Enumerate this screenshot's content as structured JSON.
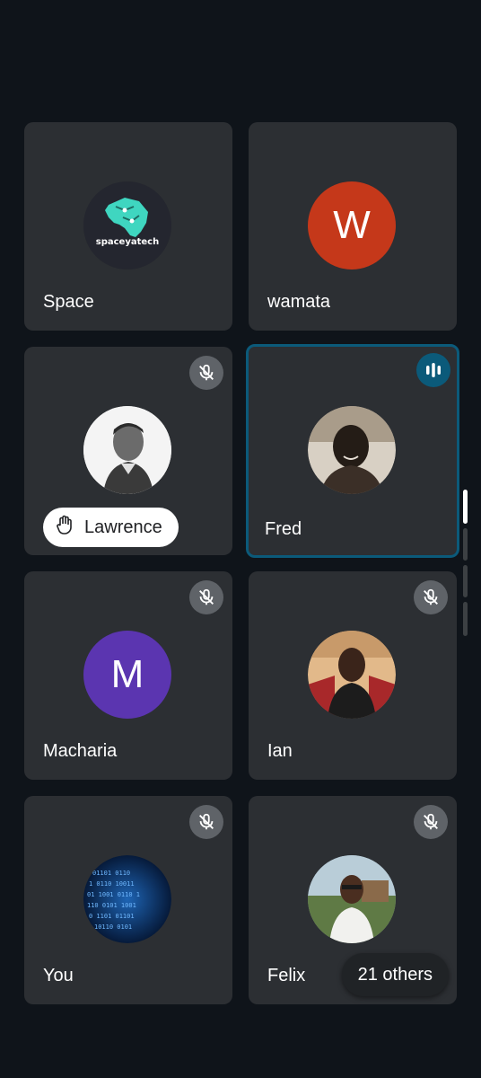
{
  "colors": {
    "background": "#0f141a",
    "tile": "#2c2f33",
    "speaking_border": "#0b5a7a",
    "mute_badge": "#5f6368"
  },
  "participants": [
    {
      "name": "Space",
      "avatar_text": "spaceyatech",
      "avatar_type": "logo",
      "muted": false
    },
    {
      "name": "wamata",
      "avatar_letter": "W",
      "avatar_color": "#c5381a",
      "muted": false
    },
    {
      "name": "Lawrence",
      "avatar_type": "photo",
      "muted": true,
      "hand_raised": true,
      "hand_icon": "raised-hand-icon"
    },
    {
      "name": "Fred",
      "avatar_type": "photo",
      "muted": false,
      "speaking": true,
      "speaking_icon": "audio-level-icon"
    },
    {
      "name": "Macharia",
      "avatar_letter": "M",
      "avatar_color": "#5b35b0",
      "muted": true
    },
    {
      "name": "Ian",
      "avatar_type": "photo",
      "muted": true
    },
    {
      "name": "You",
      "avatar_type": "photo",
      "muted": true
    },
    {
      "name": "Felix",
      "avatar_type": "photo",
      "muted": true
    }
  ],
  "others_label": "21 others",
  "icons": {
    "mute": "mic-off-icon"
  }
}
